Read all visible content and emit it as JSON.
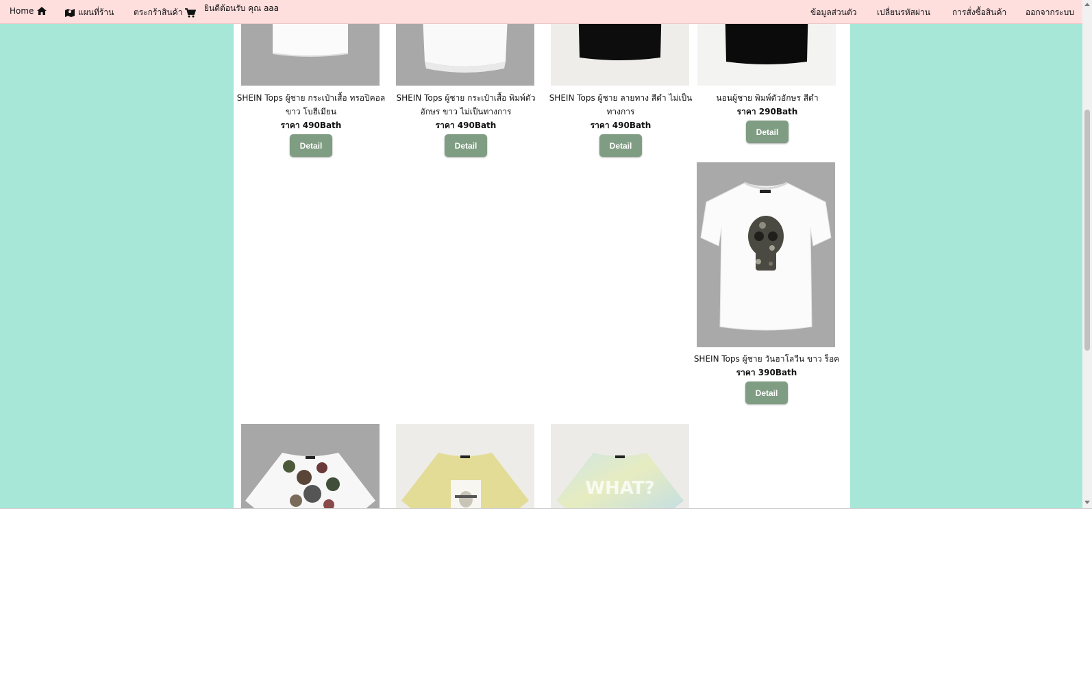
{
  "nav": {
    "home": "Home",
    "map": "แผนที่ร้าน",
    "cart": "ตระกร้าสินค้า",
    "welcome": "ยินดีต้อนรับ คุณ aaa",
    "profile": "ข้อมูลส่วนตัว",
    "change_password": "เปลี่ยนรหัสผ่าน",
    "orders": "การสั่งซื้อสินค้า",
    "logout": "ออกจากระบบ"
  },
  "products": [
    {
      "name": "SHEIN Tops ผู้ชาย กระเป๋าเสื้อ ทรอปิคอล ขาว โบฮีเมียน",
      "price": "ราคา 490Bath",
      "button": "Detail"
    },
    {
      "name": "SHEIN Tops ผู้ชาย กระเป๋าเสื้อ พิมพ์ตัวอักษร ขาว ไม่เป็นทางการ",
      "price": "ราคา 490Bath",
      "button": "Detail"
    },
    {
      "name": "SHEIN Tops ผู้ชาย ลายทาง สีดำ ไม่เป็นทางการ",
      "price": "ราคา 490Bath",
      "button": "Detail"
    },
    {
      "name": "นอนผู้ชาย พิมพ์ตัวอักษร สีดำ",
      "price": "ราคา 290Bath",
      "button": "Detail"
    },
    {
      "name": "SHEIN Tops ผู้ชาย วันฮาโลวีน ขาว ร็อค",
      "price": "ราคา 390Bath",
      "button": "Detail"
    }
  ],
  "bottom_row_images": [
    "floral-shirt-image",
    "yellow-print-shirt-image",
    "tie-dye-what-shirt-image"
  ],
  "bottom_row_text": "WHAT?",
  "colors": {
    "page_background": "#a6e7d8",
    "navbar": "#ffdede",
    "button": "#7f9d82"
  }
}
